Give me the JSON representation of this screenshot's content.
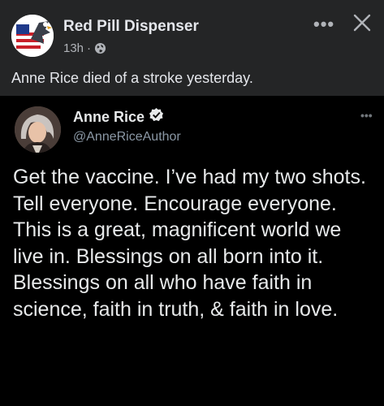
{
  "post": {
    "author": "Red Pill Dispenser",
    "time": "13h",
    "separator": "·",
    "caption": "Anne Rice died of a stroke yesterday.",
    "more_icon": "ellipsis-icon",
    "close_icon": "close-icon",
    "privacy_icon": "globe-icon"
  },
  "tweet": {
    "name": "Anne Rice",
    "handle": "@AnneRiceAuthor",
    "verified_icon": "verified-badge-icon",
    "more_icon": "ellipsis-icon",
    "text": "Get the vaccine. I’ve had my two shots. Tell everyone. Encourage everyone. This is a great, magnificent world we live in. Blessings on all born into it. Blessings on all who have faith in science, faith in truth, & faith in love."
  },
  "colors": {
    "fb_background": "#242526",
    "tweet_background": "#000000",
    "primary_text": "#e4e6eb",
    "secondary_text": "#b0b3b8",
    "handle_text": "#8b98a5"
  }
}
